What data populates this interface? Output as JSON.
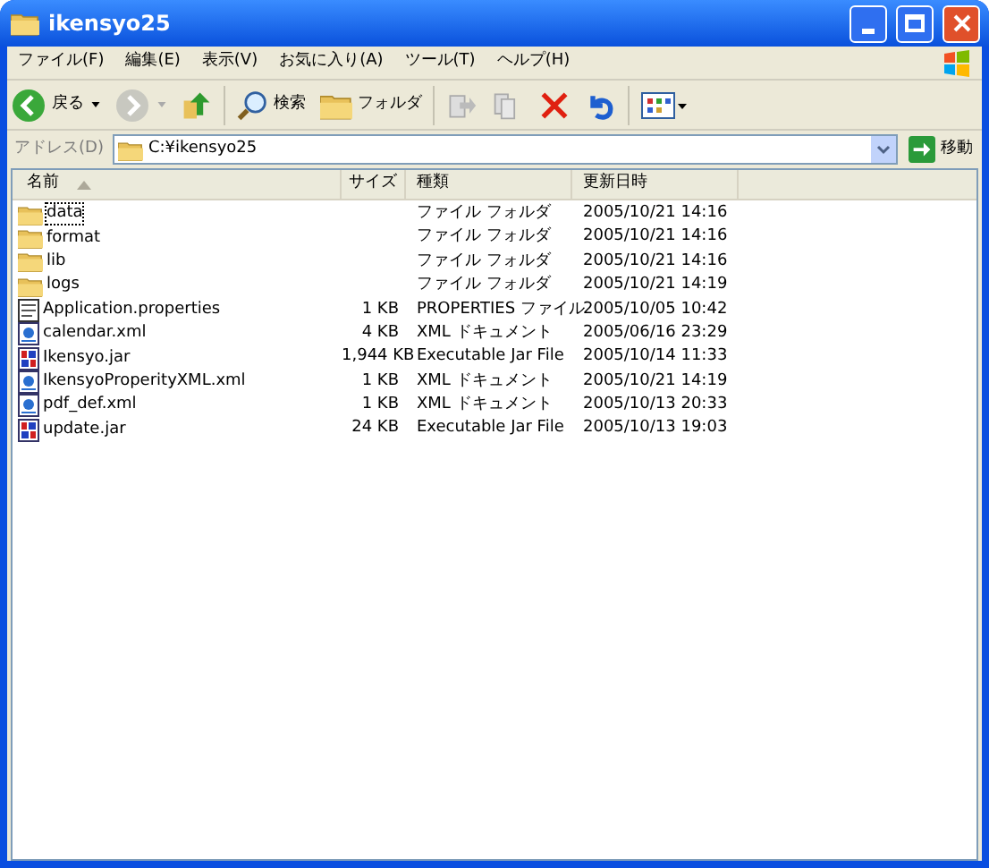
{
  "window": {
    "title": "ikensyo25"
  },
  "menu": [
    "ファイル(F)",
    "編集(E)",
    "表示(V)",
    "お気に入り(A)",
    "ツール(T)",
    "ヘルプ(H)"
  ],
  "toolbar": {
    "back": "戻る",
    "search": "検索",
    "folders": "フォルダ"
  },
  "address": {
    "label": "アドレス(D)",
    "value": "C:¥ikensyo25",
    "go": "移動"
  },
  "columns": [
    "名前",
    "サイズ",
    "種類",
    "更新日時"
  ],
  "files": [
    {
      "kind": "folder",
      "name": "data",
      "type": "ファイル フォルダ",
      "date": "2005/10/21 14:16",
      "focused": true
    },
    {
      "kind": "folder",
      "name": "format",
      "type": "ファイル フォルダ",
      "date": "2005/10/21 14:16",
      "focused": false
    },
    {
      "kind": "folder",
      "name": "lib",
      "type": "ファイル フォルダ",
      "date": "2005/10/21 14:16",
      "focused": false
    },
    {
      "kind": "folder",
      "name": "logs",
      "type": "ファイル フォルダ",
      "date": "2005/10/21 14:19",
      "focused": false
    },
    {
      "kind": "properties",
      "name": "Application.properties",
      "size": "1 KB",
      "type": "PROPERTIES ファイル",
      "date": "2005/10/05 10:42",
      "focused": false
    },
    {
      "kind": "xml",
      "name": "calendar.xml",
      "size": "4 KB",
      "type": "XML ドキュメント",
      "date": "2005/06/16 23:29",
      "focused": false
    },
    {
      "kind": "jar",
      "name": "Ikensyo.jar",
      "size": "1,944 KB",
      "type": "Executable Jar File",
      "date": "2005/10/14 11:33",
      "focused": false
    },
    {
      "kind": "xml",
      "name": "IkensyoProperityXML.xml",
      "size": "1 KB",
      "type": "XML ドキュメント",
      "date": "2005/10/21 14:19",
      "focused": false
    },
    {
      "kind": "xml",
      "name": "pdf_def.xml",
      "size": "1 KB",
      "type": "XML ドキュメント",
      "date": "2005/10/13 20:33",
      "focused": false
    },
    {
      "kind": "jar",
      "name": "update.jar",
      "size": "24 KB",
      "type": "Executable Jar File",
      "date": "2005/10/13 19:03",
      "focused": false
    }
  ]
}
